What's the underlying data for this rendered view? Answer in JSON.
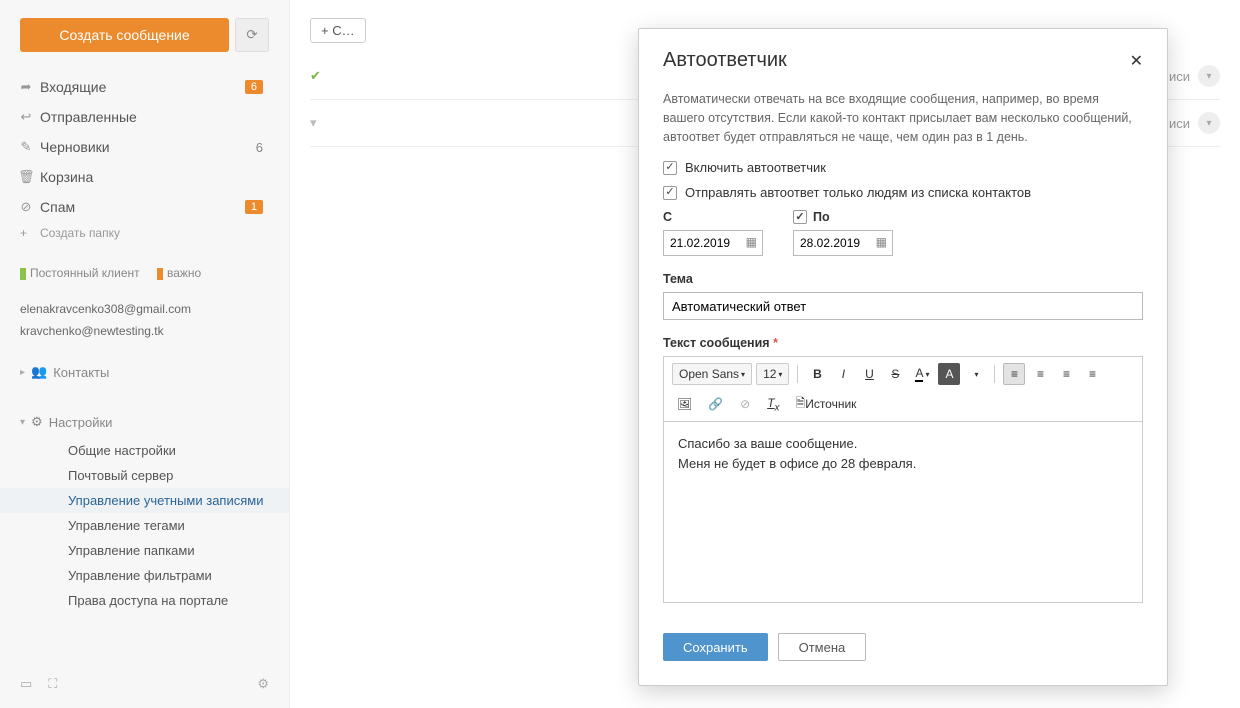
{
  "sidebar": {
    "compose": "Создать сообщение",
    "folders": [
      {
        "icon": "arrow-right",
        "label": "Входящие",
        "badge": "6"
      },
      {
        "icon": "reply",
        "label": "Отправленные"
      },
      {
        "icon": "edit",
        "label": "Черновики",
        "count": "6"
      },
      {
        "icon": "trash",
        "label": "Корзина"
      },
      {
        "icon": "ban",
        "label": "Спам",
        "badge": "1"
      }
    ],
    "add_folder": "Создать папку",
    "tags": [
      {
        "color": "green",
        "label": "Постоянный клиент"
      },
      {
        "color": "orange",
        "label": "важно"
      }
    ],
    "accounts": [
      "elenakravcenko308@gmail.com",
      "kravchenko@newtesting.tk"
    ],
    "contacts": "Контакты",
    "settings_title": "Настройки",
    "settings_items": [
      "Общие настройки",
      "Почтовый сервер",
      "Управление учетными записями",
      "Управление тегами",
      "Управление папками",
      "Управление фильтрами",
      "Права доступа на портале"
    ],
    "settings_active_index": 2
  },
  "main": {
    "add_btn": "+  С…",
    "rows": [
      {
        "status": "ok",
        "sig_label": "Настройка подписи"
      },
      {
        "status": "pending",
        "sig_label": "Настройка подписи"
      }
    ]
  },
  "modal": {
    "title": "Автоответчик",
    "description": "Автоматически отвечать на все входящие сообщения, например, во время вашего отсутствия. Если какой-то контакт присылает вам несколько сообщений, автоответ будет отправляться не чаще, чем один раз в 1 день.",
    "enable_label": "Включить автоответчик",
    "enable_checked": true,
    "contacts_only_label": "Отправлять автоответ только людям из списка контактов",
    "contacts_only_checked": true,
    "from_label": "С",
    "to_label": "По",
    "to_checked": true,
    "from_value": "21.02.2019",
    "to_value": "28.02.2019",
    "subject_label": "Тема",
    "subject_value": "Автоматический ответ",
    "body_label": "Текст сообщения",
    "font_family": "Open Sans",
    "font_size": "12",
    "source_label": "Источник",
    "body_value": "Спасибо за ваше сообщение.\nМеня не будет в офисе до 28 февраля.",
    "save": "Сохранить",
    "cancel": "Отмена"
  }
}
